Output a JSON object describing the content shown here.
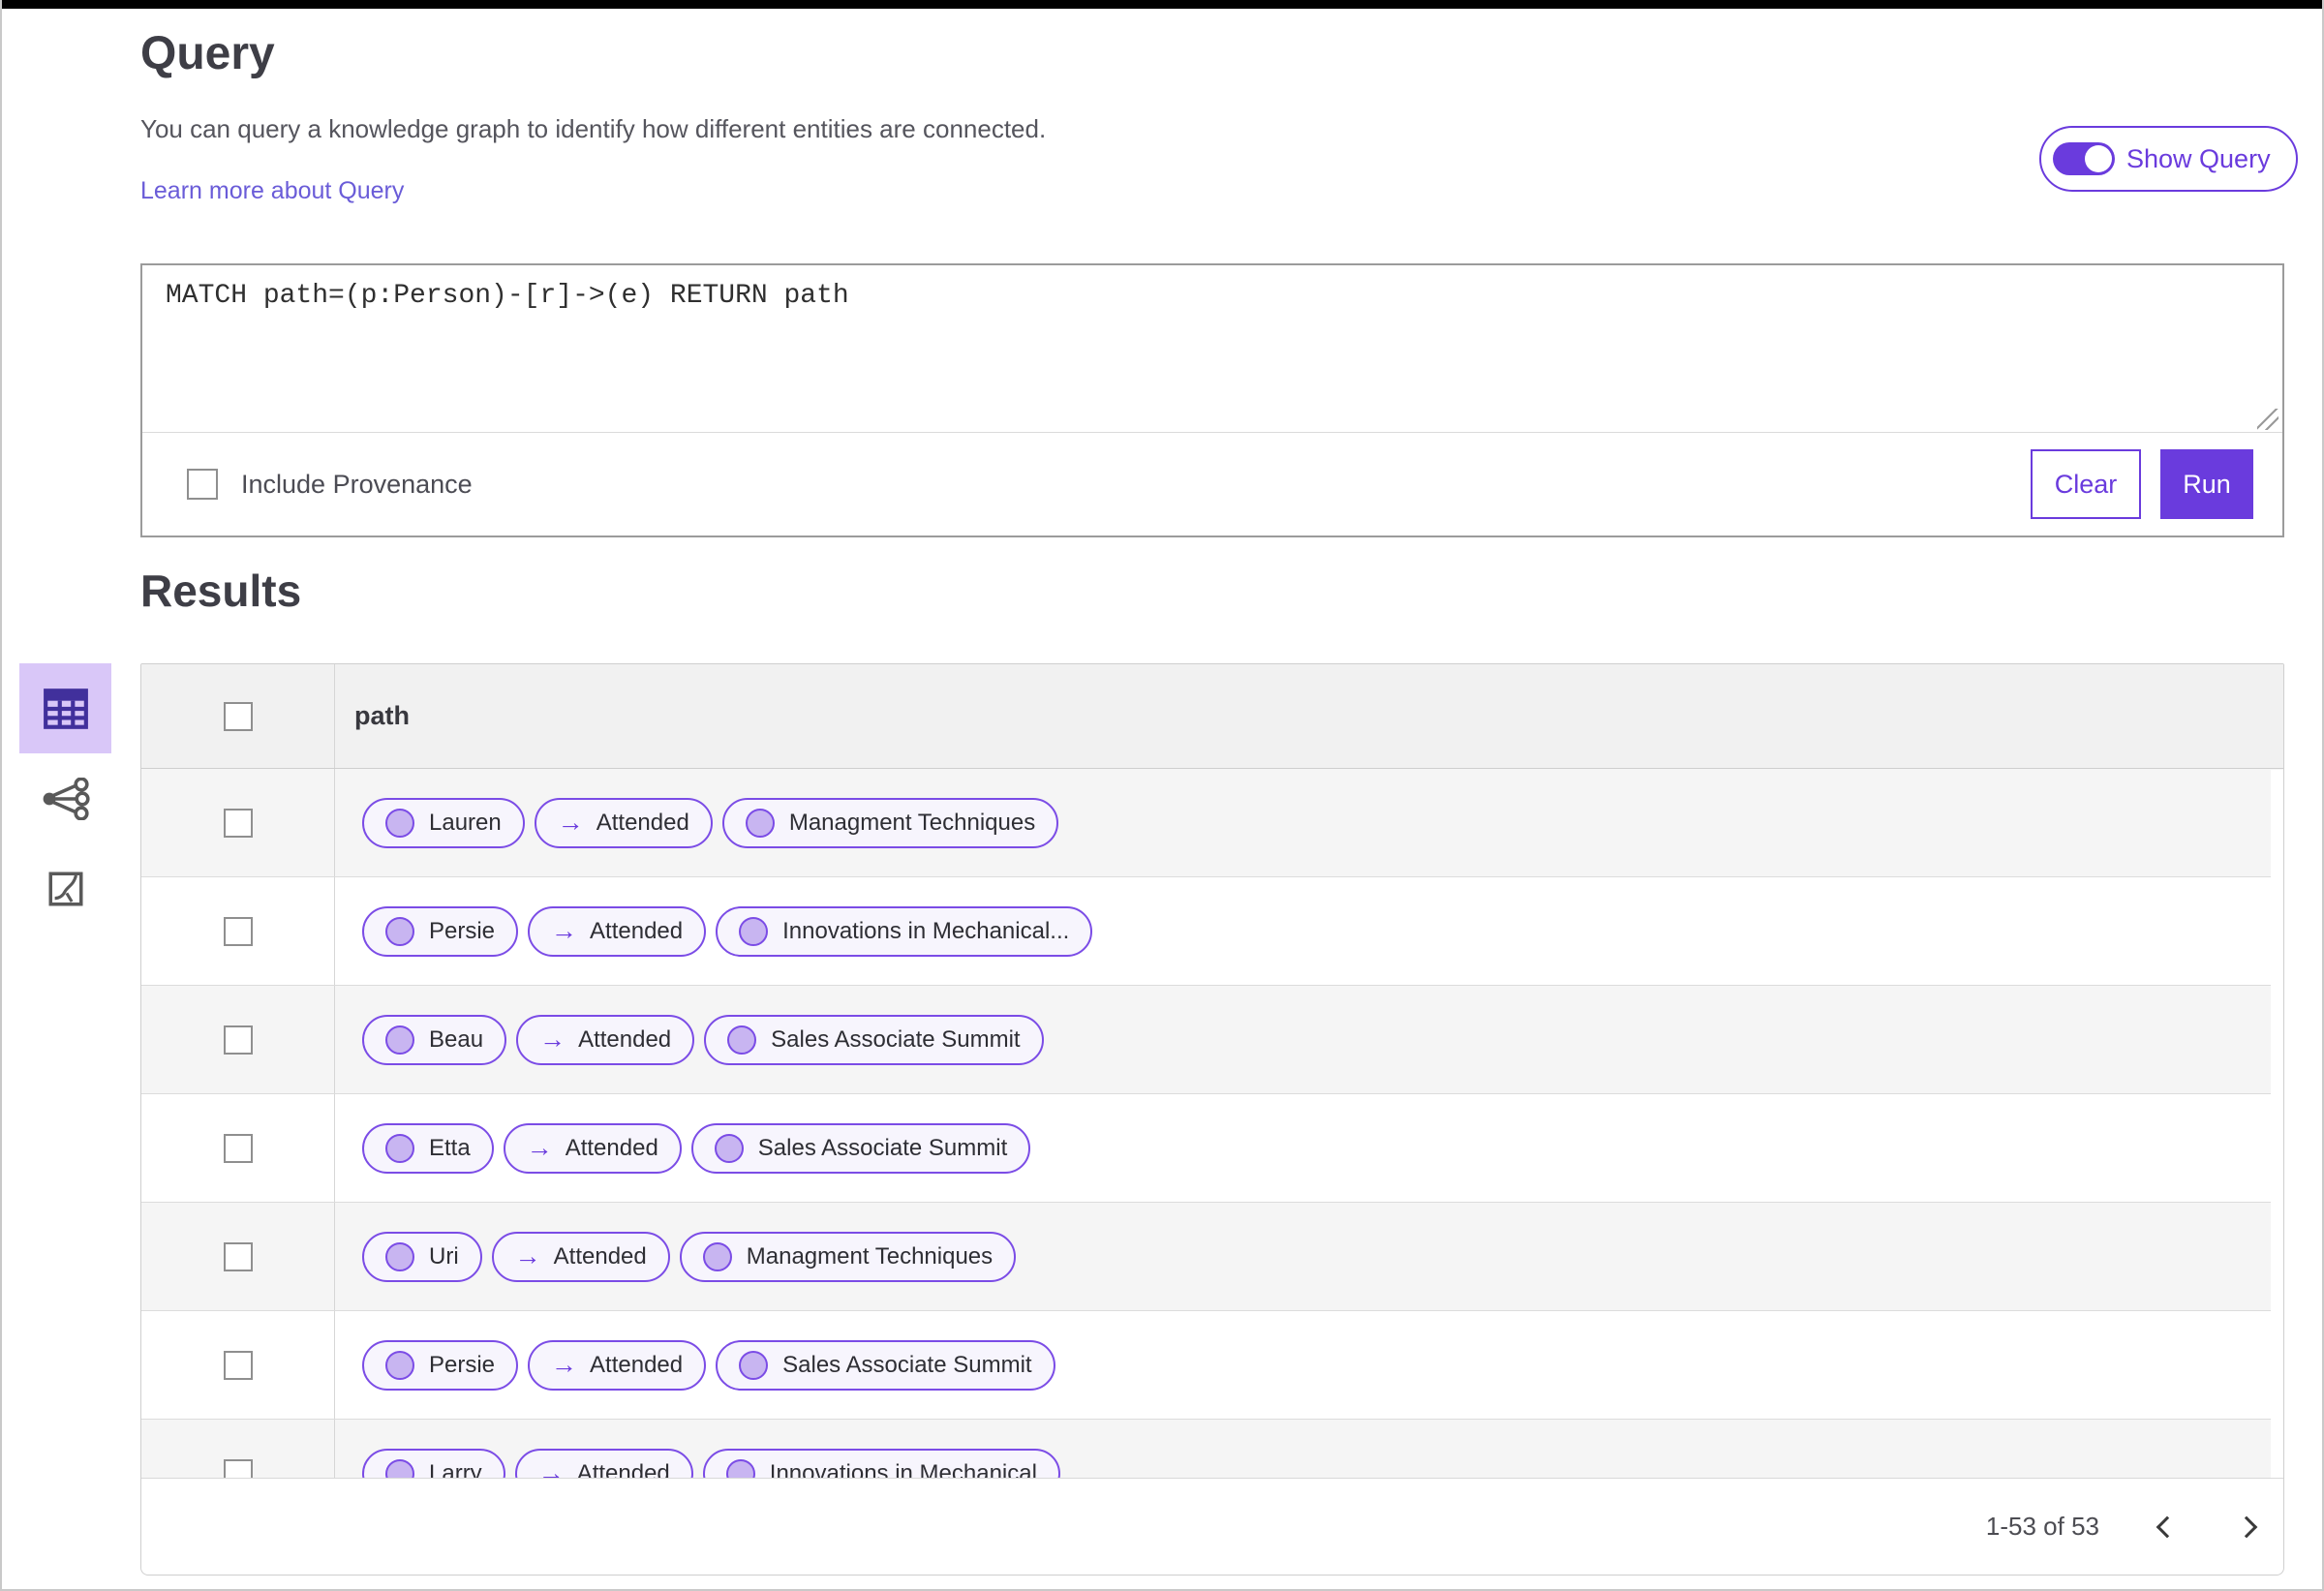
{
  "page": {
    "title": "Query",
    "description": "You can query a knowledge graph to identify how different entities are connected.",
    "learn_more_label": "Learn more about Query",
    "show_query_label": "Show Query",
    "show_query_on": true
  },
  "query_editor": {
    "text": "MATCH path=(p:Person)-[r]->(e) RETURN path",
    "include_provenance_label": "Include Provenance",
    "include_provenance_checked": false,
    "clear_label": "Clear",
    "run_label": "Run"
  },
  "results": {
    "heading": "Results",
    "column_header": "path",
    "relation_arrow": "→",
    "view_icons": [
      "table-view-icon",
      "graph-view-icon",
      "chart-view-icon"
    ],
    "selected_view": "table-view-icon",
    "rows": [
      {
        "source": "Lauren",
        "relation": "Attended",
        "target": "Managment Techniques"
      },
      {
        "source": "Persie",
        "relation": "Attended",
        "target": "Innovations in Mechanical..."
      },
      {
        "source": "Beau",
        "relation": "Attended",
        "target": "Sales Associate Summit"
      },
      {
        "source": "Etta",
        "relation": "Attended",
        "target": "Sales Associate Summit"
      },
      {
        "source": "Uri",
        "relation": "Attended",
        "target": "Managment Techniques"
      },
      {
        "source": "Persie",
        "relation": "Attended",
        "target": "Sales Associate Summit"
      },
      {
        "source": "Larry",
        "relation": "Attended",
        "target": "Innovations in Mechanical"
      }
    ],
    "pagination": {
      "range_label": "1-53 of 53"
    }
  },
  "colors": {
    "accent": "#6a3bdd",
    "pill_border": "#7b4ce6",
    "node_fill": "#c8b5f1",
    "selected_tile": "#d9c7f8",
    "rail_icon_selected": "#41309c",
    "rail_icon": "#595959",
    "link": "#6a5cd8"
  }
}
